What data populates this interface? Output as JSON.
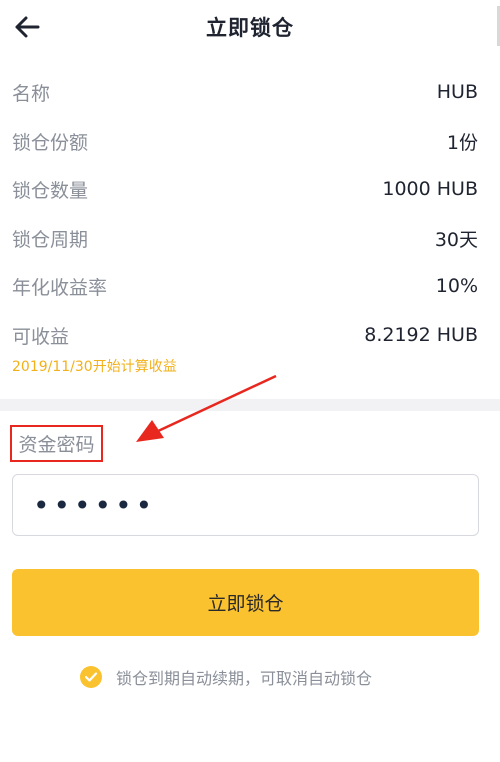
{
  "header": {
    "title": "立即锁仓",
    "back_icon": "arrow-left-icon"
  },
  "details": [
    {
      "label": "名称",
      "value": "HUB"
    },
    {
      "label": "锁仓份额",
      "value": "1份"
    },
    {
      "label": "锁仓数量",
      "value": "1000 HUB"
    },
    {
      "label": "锁仓周期",
      "value": "30天"
    },
    {
      "label": "年化收益率",
      "value": "10%"
    },
    {
      "label": "可收益",
      "value": "8.2192 HUB"
    }
  ],
  "start_note": "2019/11/30开始计算收益",
  "password": {
    "label": "资金密码",
    "value": "••••••"
  },
  "submit_label": "立即锁仓",
  "auto_renew": {
    "text": "锁仓到期自动续期，可取消自动锁仓",
    "checked": true
  },
  "colors": {
    "accent": "#fbc22f",
    "note": "#f2b11b",
    "annotation": "#e8271f"
  }
}
